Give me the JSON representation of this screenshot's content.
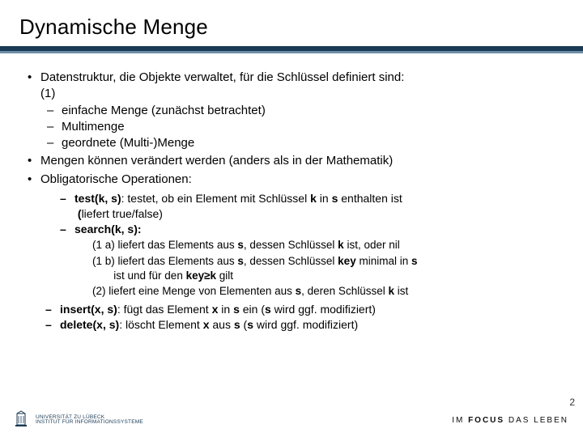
{
  "title": "Dynamische Menge",
  "bullets": {
    "b1_line1": "Datenstruktur, die Objekte verwaltet, für die Schlüssel definiert sind:",
    "b1_line2": "(1)",
    "b1_sub1": "einfache Menge (zunächst betrachtet)",
    "b1_sub2": "Multimenge",
    "b1_sub3": "geordnete (Multi-)Menge",
    "b2": "Mengen können verändert werden (anders als in der Mathematik)",
    "b3": "Obligatorische Operationen:"
  },
  "ops": {
    "test_pre": "test",
    "test_paren_open": "(",
    "test_k": "k",
    "test_comma": ", ",
    "test_s": "s",
    "test_paren_close": ")",
    "test_after": ": testet, ob ein Element mit Schlüssel ",
    "test_k2": "k",
    "test_mid": " in ",
    "test_s2": "s",
    "test_end": " enthalten ist",
    "test_sub_open": "(",
    "test_sub_rest": "liefert true/false)",
    "search_pre": "search",
    "search_paren_open": "(",
    "search_k": "k",
    "search_comma": ", ",
    "search_s": "s",
    "search_paren_close": ")",
    "search_colon": ":",
    "s_a_pre": "(1 a) liefert das Elements aus ",
    "s_a_s": "s",
    "s_a_mid": ", dessen Schlüssel ",
    "s_a_k": "k",
    "s_a_end": " ist, oder nil",
    "s_b_pre": "(1 b) liefert das Elements aus ",
    "s_b_s": "s",
    "s_b_mid": ", dessen Schlüssel ",
    "s_b_key": "key",
    "s_b_end": " minimal in ",
    "s_b_s2": "s",
    "s_b_line2a": "ist und für den ",
    "s_b_line2k": "key≥k",
    "s_b_line2end": " gilt",
    "s_c_pre": "(2) liefert eine Menge von Elementen aus ",
    "s_c_s": "s",
    "s_c_mid": ", deren Schlüssel ",
    "s_c_k": "k",
    "s_c_end": " ist",
    "insert_pre": "insert",
    "insert_paren_open": "(",
    "insert_x": "x",
    "insert_comma": ", ",
    "insert_s": "s",
    "insert_paren_close": ")",
    "insert_after": ": fügt das Element ",
    "insert_x2": "x",
    "insert_mid": " in ",
    "insert_s2": "s",
    "insert_end": " ein (",
    "insert_s3": "s",
    "insert_end2": " wird ggf. modifiziert)",
    "delete_pre": "delete",
    "delete_paren_open": "(",
    "delete_x": "x",
    "delete_comma": ", ",
    "delete_s": "s",
    "delete_paren_close": ")",
    "delete_after": ": löscht Element ",
    "delete_x2": "x",
    "delete_mid": " aus ",
    "delete_s2": "s",
    "delete_end": " (",
    "delete_s3": "s",
    "delete_end2": " wird ggf. modifiziert)"
  },
  "footer": {
    "uni_line1": "UNIVERSITÄT ZU LÜBECK",
    "uni_line2": "INSTITUT FÜR INFORMATIONSSYSTEME",
    "focus_im": "IM ",
    "focus_bold": "FOCUS",
    "focus_rest": " DAS LEBEN"
  },
  "page": "2"
}
